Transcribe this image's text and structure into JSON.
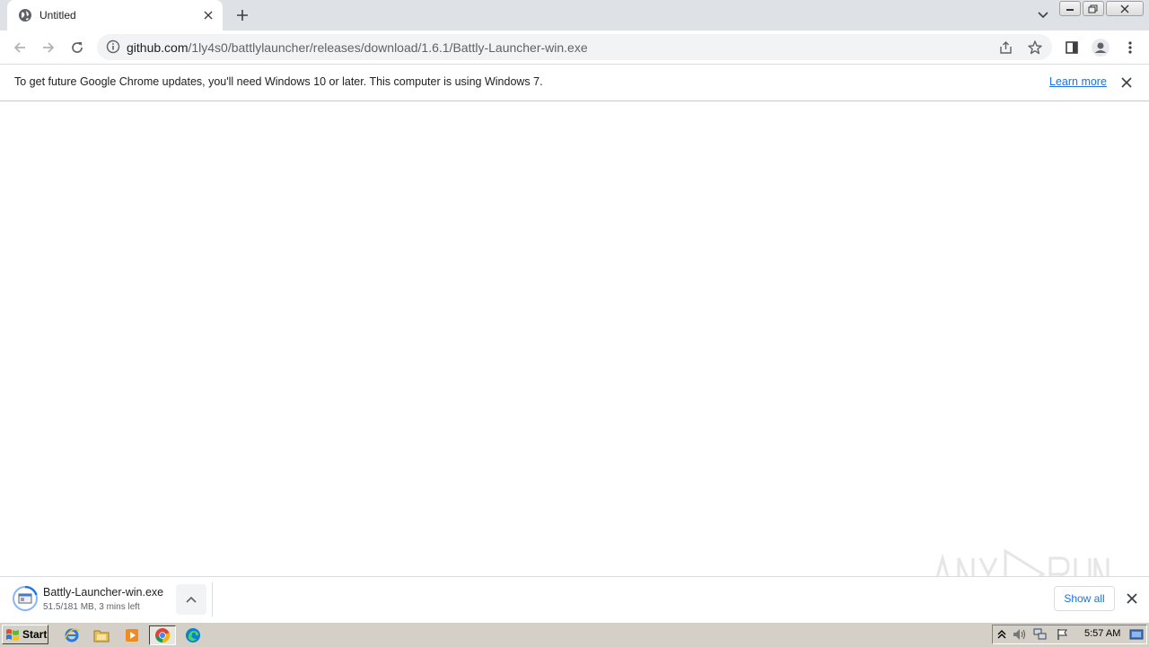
{
  "browser": {
    "tab": {
      "title": "Untitled"
    },
    "omnibox": {
      "host": "github.com",
      "path": "/1ly4s0/battlylauncher/releases/download/1.6.1/Battly-Launcher-win.exe"
    },
    "infobar": {
      "message": "To get future Google Chrome updates, you'll need Windows 10 or later. This computer is using Windows 7.",
      "link_label": "Learn more"
    }
  },
  "download_shelf": {
    "file_name": "Battly-Launcher-win.exe",
    "status": "51.5/181 MB, 3 mins left",
    "show_all_label": "Show all"
  },
  "taskbar": {
    "start_label": "Start",
    "clock": "5:57 AM"
  },
  "colors": {
    "tabstrip_bg": "#dee1e6",
    "link_blue": "#1a73e8",
    "taskbar_bg": "#d4d0c8"
  },
  "watermark": {
    "text": "ANY RUN"
  }
}
